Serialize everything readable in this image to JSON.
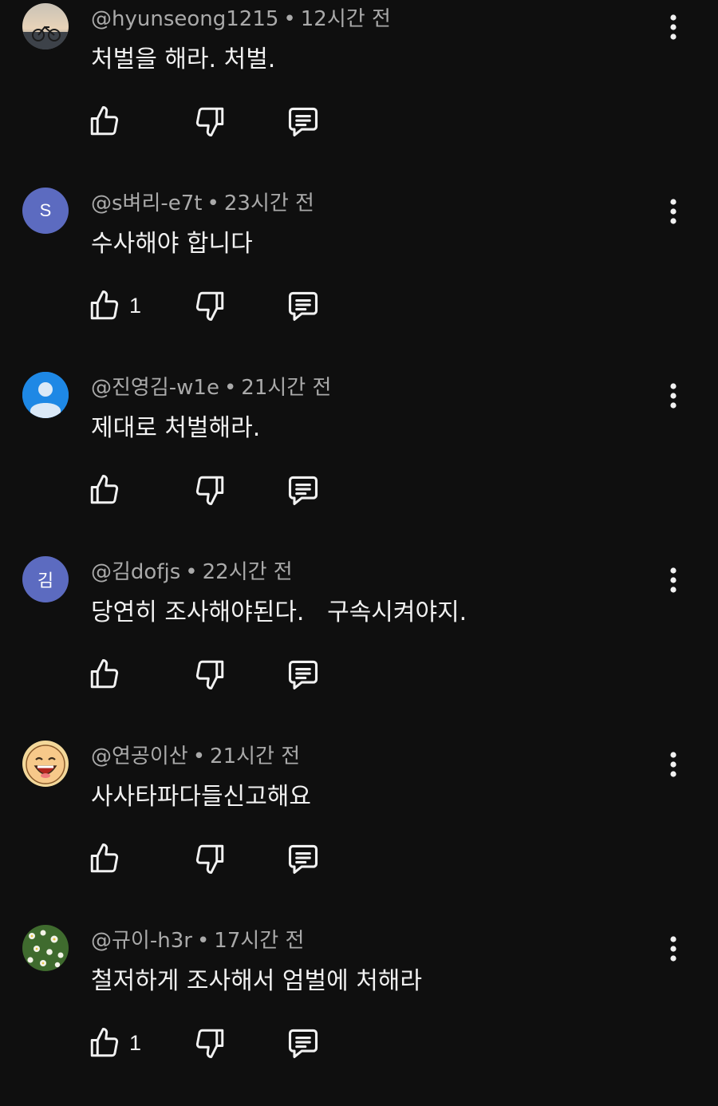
{
  "colors": {
    "background": "#0f0f0f",
    "text": "#f1f1f1",
    "meta": "#aaaaaa",
    "avatar_purple": "#5c6bc0",
    "avatar_blue": "#1e88e5"
  },
  "comments": [
    {
      "author": "@hyunseong1215",
      "separator": "•",
      "time": "12시간 전",
      "text": "처벌을 해라. 처벌.",
      "likes": "",
      "avatar": {
        "type": "photo-bike",
        "letter": ""
      },
      "more_icon": "more-vert-icon"
    },
    {
      "author": "@s벼리-e7t",
      "separator": "•",
      "time": "23시간 전",
      "text": "수사해야 합니다",
      "likes": "1",
      "avatar": {
        "type": "letter",
        "letter": "S",
        "color": "#5c6bc0"
      },
      "more_icon": "more-vert-icon"
    },
    {
      "author": "@진영김-w1e",
      "separator": "•",
      "time": "21시간 전",
      "text": "제대로 처벌해라.",
      "likes": "",
      "avatar": {
        "type": "default-person",
        "letter": "",
        "color": "#1e88e5"
      },
      "more_icon": "more-vert-icon"
    },
    {
      "author": "@김dofjs",
      "separator": "•",
      "time": "22시간 전",
      "text": "당연히 조사해야된다.   구속시켜야지.",
      "likes": "",
      "avatar": {
        "type": "letter",
        "letter": "김",
        "color": "#5c6bc0"
      },
      "more_icon": "more-vert-icon"
    },
    {
      "author": "@연공이산",
      "separator": "•",
      "time": "21시간 전",
      "text": "사사타파다들신고해요",
      "likes": "",
      "avatar": {
        "type": "photo-laughing-face",
        "letter": ""
      },
      "more_icon": "more-vert-icon"
    },
    {
      "author": "@규이-h3r",
      "separator": "•",
      "time": "17시간 전",
      "text": "철저하게 조사해서 엄벌에 처해라",
      "likes": "1",
      "avatar": {
        "type": "photo-flowers",
        "letter": ""
      },
      "more_icon": "more-vert-icon"
    }
  ],
  "icons": {
    "like": "thumb-up-icon",
    "dislike": "thumb-down-icon",
    "reply": "reply-comment-icon"
  }
}
